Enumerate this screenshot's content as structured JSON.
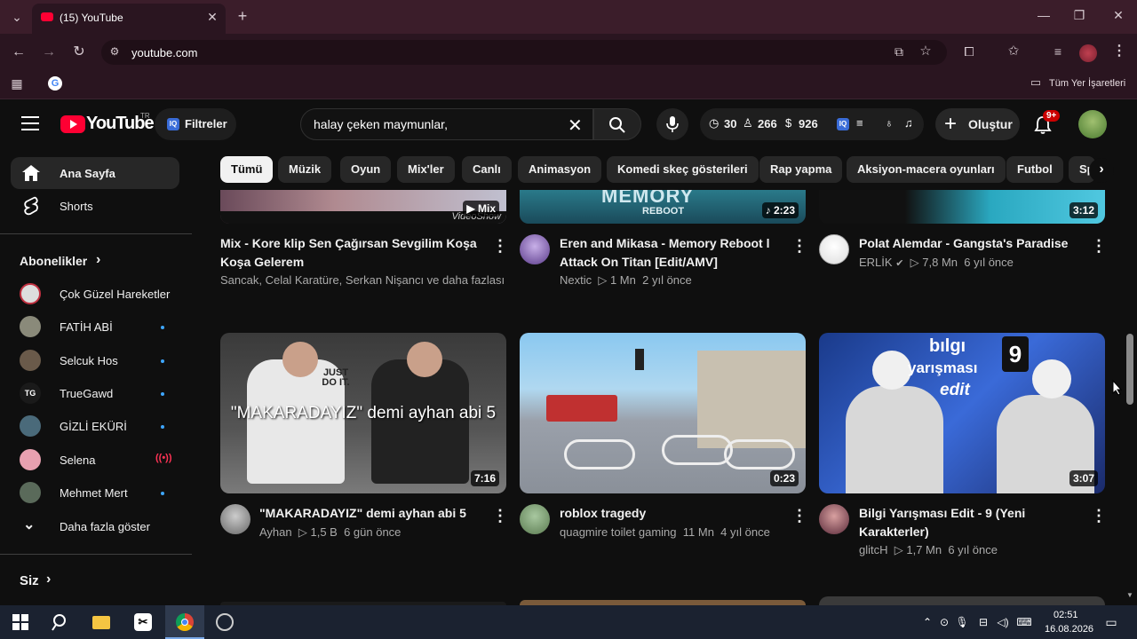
{
  "browser": {
    "tab_title": "(15) YouTube",
    "url": "youtube.com",
    "bookmarks_label": "Tüm Yer İşaretleri"
  },
  "header": {
    "logo_text": "YouTube",
    "logo_country": "TR",
    "filter_label": "Filtreler",
    "search_value": "halay çeken maymunlar,",
    "ext_count1": "30",
    "ext_count2": "266",
    "ext_count3": "926",
    "create_label": "Oluştur",
    "notif_badge": "9+"
  },
  "chips": [
    "Tümü",
    "Müzik",
    "Oyun",
    "Mix'ler",
    "Canlı",
    "Animasyon",
    "Komedi skeç gösterileri",
    "Rap yapma",
    "Aksiyon-macera oyunları",
    "Futbol",
    "Sp"
  ],
  "sidebar": {
    "home": "Ana Sayfa",
    "shorts": "Shorts",
    "subs_header": "Abonelikler",
    "subs": [
      {
        "name": "Çok Güzel Hareketler",
        "status": "none",
        "color": "#c8c8c8"
      },
      {
        "name": "FATİH ABİ",
        "status": "new",
        "color": "#8a8a7a"
      },
      {
        "name": "Selcuk Hos",
        "status": "new",
        "color": "#6a5a4a"
      },
      {
        "name": "TrueGawd",
        "status": "new",
        "color": "#1a1a1a"
      },
      {
        "name": "GİZLİ EKÜRİ",
        "status": "new",
        "color": "#4a6a7a"
      },
      {
        "name": "Selena",
        "status": "live",
        "color": "#e8a0b0"
      },
      {
        "name": "Mehmet Mert",
        "status": "new",
        "color": "#5a6a5a"
      }
    ],
    "show_more": "Daha fazla göster",
    "you_header": "Siz"
  },
  "videos_top": [
    {
      "title": "Mix - Kore klip Sen Çağırsan Sevgilim Koşa Koşa Gelerem",
      "meta": "Sancak, Celal Karatüre, Serkan Nişancı ve daha fazlası",
      "badge": "Mix",
      "watermark": "VideoShow"
    },
    {
      "title": "Eren and Mikasa - Memory Reboot l Attack On Titan [Edit/AMV]",
      "channel": "Nextic",
      "views": "1 Mn",
      "age": "2 yıl önce",
      "duration": "2:23",
      "thumb_text": "MEMORY",
      "thumb_sub": "REBOOT"
    },
    {
      "title": "Polat Alemdar - Gangsta's Paradise",
      "channel": "ERLİK",
      "views": "7,8 Mn",
      "age": "6 yıl önce",
      "duration": "3:12"
    }
  ],
  "videos_bottom": [
    {
      "title": "\"MAKARADAYIZ\" demi ayhan abi 5",
      "channel": "Ayhan",
      "views": "1,5 B",
      "age": "6 gün önce",
      "duration": "7:16",
      "overlay": "\"MAKARADAYIZ\" demi ayhan abi 5",
      "shirt": "JUST DO IT."
    },
    {
      "title": "roblox tragedy",
      "channel": "quagmire toilet gaming",
      "views": "11 Mn",
      "age": "4 yıl önce",
      "duration": "0:23"
    },
    {
      "title": "Bilgi Yarışması Edit - 9 (Yeni Karakterler)",
      "channel": "glitcH",
      "views": "1,7 Mn",
      "age": "6 yıl önce",
      "duration": "3:07",
      "thumb_line1": "bılgı",
      "thumb_line2": "yarışması",
      "thumb_line3": "edit",
      "thumb_num": "9"
    }
  ],
  "taskbar": {
    "time": "02:51",
    "date": "16.08.2026"
  },
  "colors": {
    "chrome_bg": "#3b1d2a",
    "yt_red": "#ff0033",
    "page_bg": "#0f0f0f"
  }
}
